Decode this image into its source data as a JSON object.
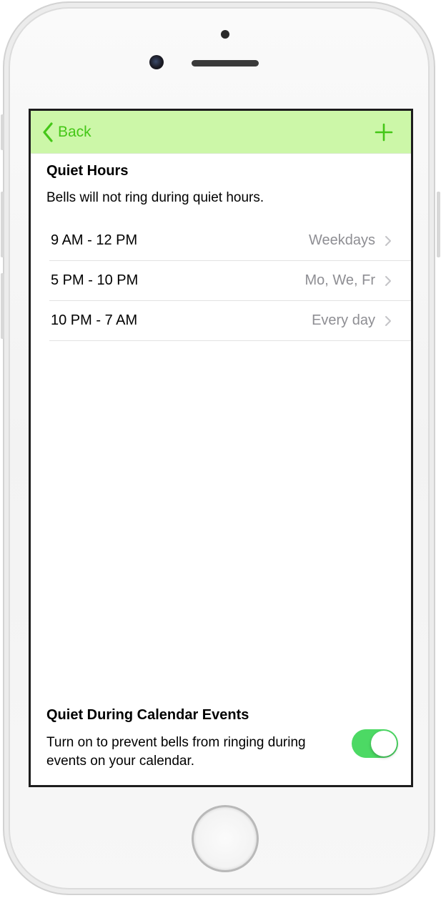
{
  "colors": {
    "accent": "#44c717",
    "navbar_bg": "#ccf7a8",
    "toggle_on": "#4cd964",
    "secondary_text": "#8e8e93"
  },
  "navbar": {
    "back_label": "Back",
    "back_icon": "chevron-left-icon",
    "add_icon": "plus-icon"
  },
  "quiet_hours": {
    "title": "Quiet Hours",
    "description": "Bells will not ring during quiet hours.",
    "items": [
      {
        "time": "9 AM - 12 PM",
        "days": "Weekdays"
      },
      {
        "time": "5 PM - 10 PM",
        "days": "Mo, We, Fr"
      },
      {
        "time": "10 PM - 7 AM",
        "days": "Every day"
      }
    ]
  },
  "calendar": {
    "title": "Quiet During Calendar Events",
    "description": "Turn on to prevent bells from ringing during events on your calendar.",
    "toggle_on": true
  }
}
